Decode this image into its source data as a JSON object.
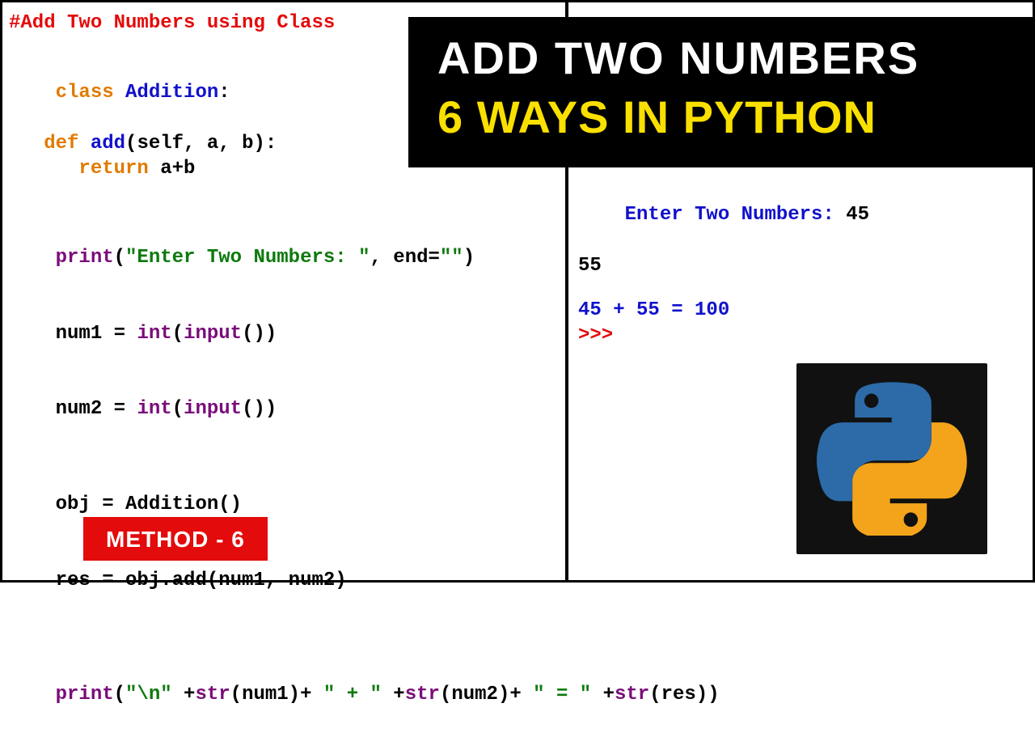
{
  "banner": {
    "line1": "ADD TWO NUMBERS",
    "line2": "6 WAYS IN PYTHON"
  },
  "badge": {
    "label": "METHOD - 6"
  },
  "code": {
    "comment": "#Add Two Numbers using Class",
    "kw_class": "class",
    "cls_name": " Addition",
    "colon": ":",
    "kw_def": "def",
    "fn_name": " add",
    "params": "(self, a, b):",
    "kw_return": "return",
    "ret_expr": " a+b",
    "p1_print": "print",
    "p1_open": "(",
    "p1_str": "\"Enter Two Numbers: \"",
    "p1_mid": ", end=",
    "p1_end": "\"\"",
    "p1_close": ")",
    "n1_left": "num1 = ",
    "n2_left": "num2 = ",
    "int_call": "int",
    "input_call": "input",
    "pp": "()",
    "close": ")",
    "open": "(",
    "obj_line_left": "obj = ",
    "obj_ctor": "Addition",
    "res_left": "res = obj.add",
    "res_args": "(num1, num2)",
    "p2_print": "print",
    "p2_open": "(",
    "p2_s1": "\"\\n\"",
    "p2_plus": " +",
    "p2_str": "str",
    "p2_a1o": "(num1)+ ",
    "p2_q_plus": "\" + \"",
    "p2_a2o": "(num2)+ ",
    "p2_q_eq": "\" = \"",
    "p2_a3o": "(res))"
  },
  "output": {
    "prompt_label": "Enter Two Numbers: ",
    "in1": "45",
    "in2": "55",
    "result": "45 + 55 = 100",
    "repl": ">>> "
  }
}
